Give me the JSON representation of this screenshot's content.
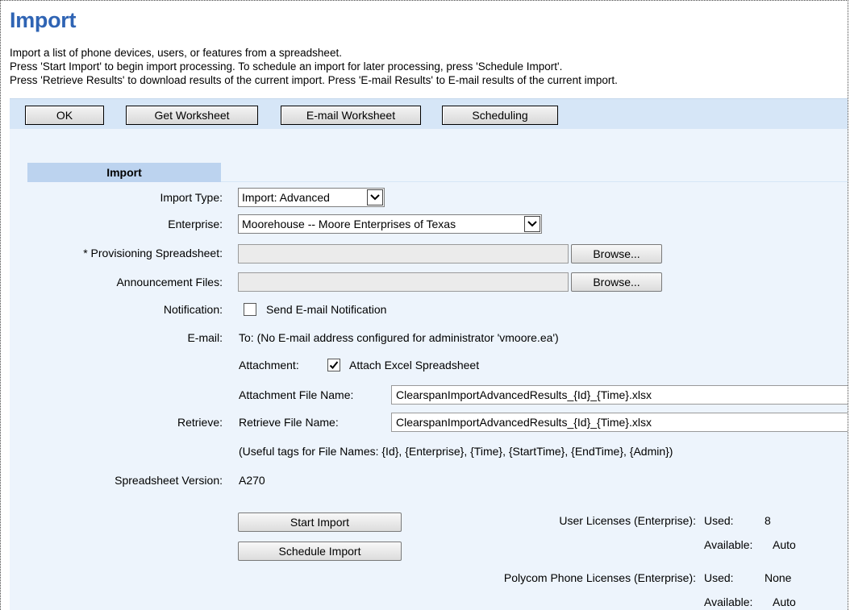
{
  "page": {
    "title": "Import",
    "instructions": [
      "Import a list of phone devices, users, or features from a spreadsheet.",
      "Press 'Start Import' to begin import processing.  To schedule an import for later processing, press 'Schedule Import'.",
      "Press 'Retrieve Results' to download results of the current import.  Press 'E-mail Results' to E-mail results of the current import."
    ]
  },
  "toolbar": {
    "ok": "OK",
    "get_worksheet": "Get Worksheet",
    "email_worksheet": "E-mail Worksheet",
    "scheduling": "Scheduling"
  },
  "section": {
    "title": "Import"
  },
  "form": {
    "import_type": {
      "label": "Import Type:",
      "value": "Import: Advanced"
    },
    "enterprise": {
      "label": "Enterprise:",
      "value": "Moorehouse -- Moore Enterprises of Texas"
    },
    "provisioning": {
      "label": "* Provisioning Spreadsheet:",
      "browse": "Browse..."
    },
    "announcement": {
      "label": "Announcement Files:",
      "browse": "Browse..."
    },
    "notification": {
      "label": "Notification:",
      "checkbox_label": "Send E-mail Notification",
      "checked": false
    },
    "email": {
      "label": "E-mail:",
      "to_text": "To:  (No E-mail address configured for administrator 'vmoore.ea')",
      "attachment_label": "Attachment:",
      "attachment_checkbox_label": "Attach Excel Spreadsheet",
      "attachment_checked": true,
      "attachment_file_label": "Attachment File Name:",
      "attachment_file_value": "ClearspanImportAdvancedResults_{Id}_{Time}.xlsx"
    },
    "retrieve": {
      "label": "Retrieve:",
      "file_label": "Retrieve File Name:",
      "file_value": "ClearspanImportAdvancedResults_{Id}_{Time}.xlsx",
      "tags_hint": "(Useful tags for File Names: {Id}, {Enterprise}, {Time}, {StartTime}, {EndTime}, {Admin})"
    },
    "spreadsheet_version": {
      "label": "Spreadsheet Version:",
      "value": "A270"
    }
  },
  "actions": {
    "start_import": "Start Import",
    "schedule_import": "Schedule Import"
  },
  "licenses": {
    "user": {
      "label": "User Licenses (Enterprise):",
      "used_label": "Used:",
      "used_value": "8",
      "available_label": "Available:",
      "available_value": "Auto"
    },
    "polycom": {
      "label": "Polycom Phone Licenses (Enterprise):",
      "used_label": "Used:",
      "used_value": "None",
      "available_label": "Available:",
      "available_value": "Auto"
    }
  }
}
